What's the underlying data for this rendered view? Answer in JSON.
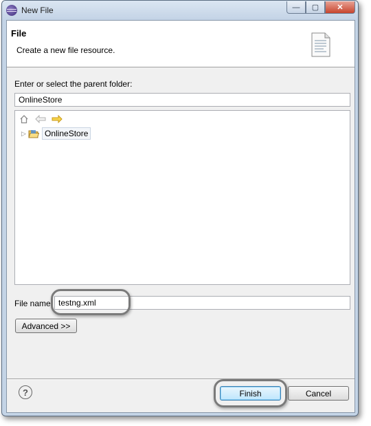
{
  "window": {
    "title": "New File",
    "controls": {
      "minimize": "—",
      "maximize": "▢",
      "close": "✕"
    }
  },
  "banner": {
    "title": "File",
    "description": "Create a new file resource."
  },
  "parent_folder": {
    "label": "Enter or select the parent folder:",
    "value": "OnlineStore"
  },
  "tree": {
    "items": [
      {
        "label": "OnlineStore",
        "icon": "open-folder-icon",
        "expanded": false
      }
    ]
  },
  "file_name": {
    "label": "File name:",
    "value": "testng.xml"
  },
  "buttons": {
    "advanced": "Advanced >>",
    "finish": "Finish",
    "cancel": "Cancel",
    "help": "?"
  },
  "colors": {
    "frame": "#c4d4e6",
    "client": "#f0f0f0",
    "default_button": "#bee6fd",
    "callout": "#7a7a7a"
  }
}
